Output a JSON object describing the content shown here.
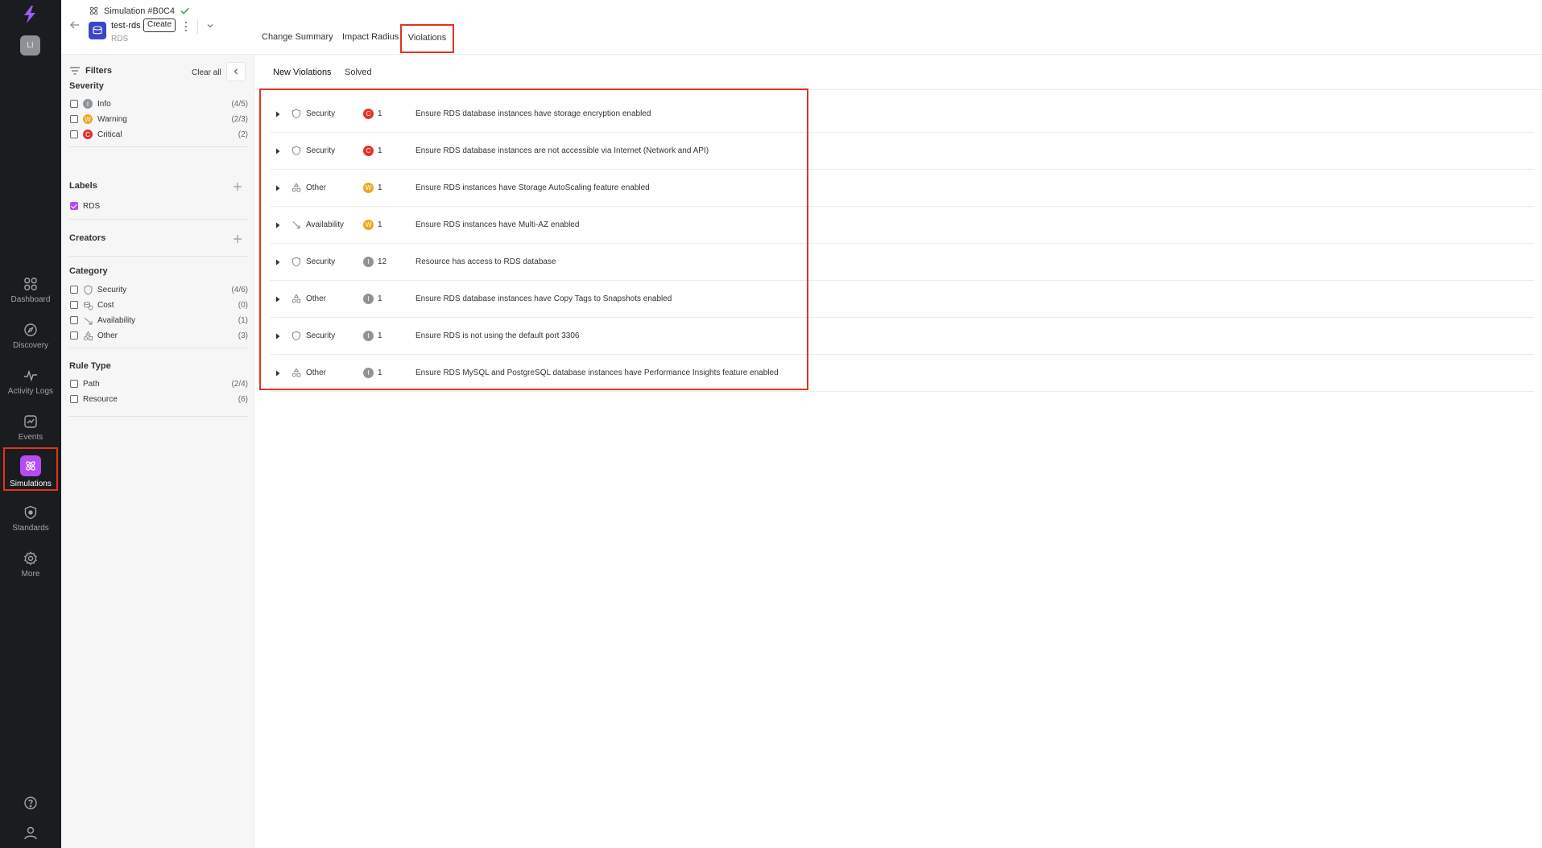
{
  "colors": {
    "critical": "#e0342f",
    "warning": "#f2a622",
    "info": "#8f949a",
    "accent": "#b54cf0",
    "highlight": "#e0341f"
  },
  "rail": {
    "avatar": "LI",
    "items": [
      {
        "label": "Dashboard",
        "icon": "dashboard-icon"
      },
      {
        "label": "Discovery",
        "icon": "compass-icon"
      },
      {
        "label": "Activity Logs",
        "icon": "activity-icon"
      },
      {
        "label": "Events",
        "icon": "events-icon"
      },
      {
        "label": "Simulations",
        "icon": "atom-icon"
      },
      {
        "label": "Standards",
        "icon": "shield-icon"
      },
      {
        "label": "More",
        "icon": "gear-icon"
      }
    ]
  },
  "header": {
    "simulation": "Simulation #B0C4",
    "resource_name": "test-rds",
    "badge": "Create",
    "resource_type": "RDS",
    "tabs": [
      "Change Summary",
      "Impact Radius",
      "Violations"
    ]
  },
  "filters": {
    "title": "Filters",
    "clear_all": "Clear all",
    "severity": {
      "title": "Severity",
      "items": [
        {
          "letter": "I",
          "label": "Info",
          "count": "(4/5)"
        },
        {
          "letter": "W",
          "label": "Warning",
          "count": "(2/3)"
        },
        {
          "letter": "C",
          "label": "Critical",
          "count": "(2)"
        }
      ]
    },
    "labels": {
      "title": "Labels",
      "items": [
        {
          "label": "RDS",
          "checked": true
        }
      ]
    },
    "creators": {
      "title": "Creators"
    },
    "category": {
      "title": "Category",
      "items": [
        {
          "label": "Security",
          "count": "(4/6)"
        },
        {
          "label": "Cost",
          "count": "(0)"
        },
        {
          "label": "Availability",
          "count": "(1)"
        },
        {
          "label": "Other",
          "count": "(3)"
        }
      ]
    },
    "rule_type": {
      "title": "Rule Type",
      "items": [
        {
          "label": "Path",
          "count": "(2/4)"
        },
        {
          "label": "Resource",
          "count": "(6)"
        }
      ]
    }
  },
  "main": {
    "subtabs": [
      "New Violations",
      "Solved"
    ],
    "violations": [
      {
        "category": "Security",
        "severity": "C",
        "count": "1",
        "description": "Ensure RDS database instances have storage encryption enabled"
      },
      {
        "category": "Security",
        "severity": "C",
        "count": "1",
        "description": "Ensure RDS database instances are not accessible via Internet (Network and API)"
      },
      {
        "category": "Other",
        "severity": "W",
        "count": "1",
        "description": "Ensure RDS instances have Storage AutoScaling feature enabled"
      },
      {
        "category": "Availability",
        "severity": "W",
        "count": "1",
        "description": "Ensure RDS instances have Multi-AZ enabled"
      },
      {
        "category": "Security",
        "severity": "I",
        "count": "12",
        "description": "Resource has access to RDS database"
      },
      {
        "category": "Other",
        "severity": "I",
        "count": "1",
        "description": "Ensure RDS database instances have Copy Tags to Snapshots enabled"
      },
      {
        "category": "Security",
        "severity": "I",
        "count": "1",
        "description": "Ensure RDS is not using the default port 3306"
      },
      {
        "category": "Other",
        "severity": "I",
        "count": "1",
        "description": "Ensure RDS MySQL and PostgreSQL database instances have Performance Insights feature enabled"
      }
    ]
  }
}
